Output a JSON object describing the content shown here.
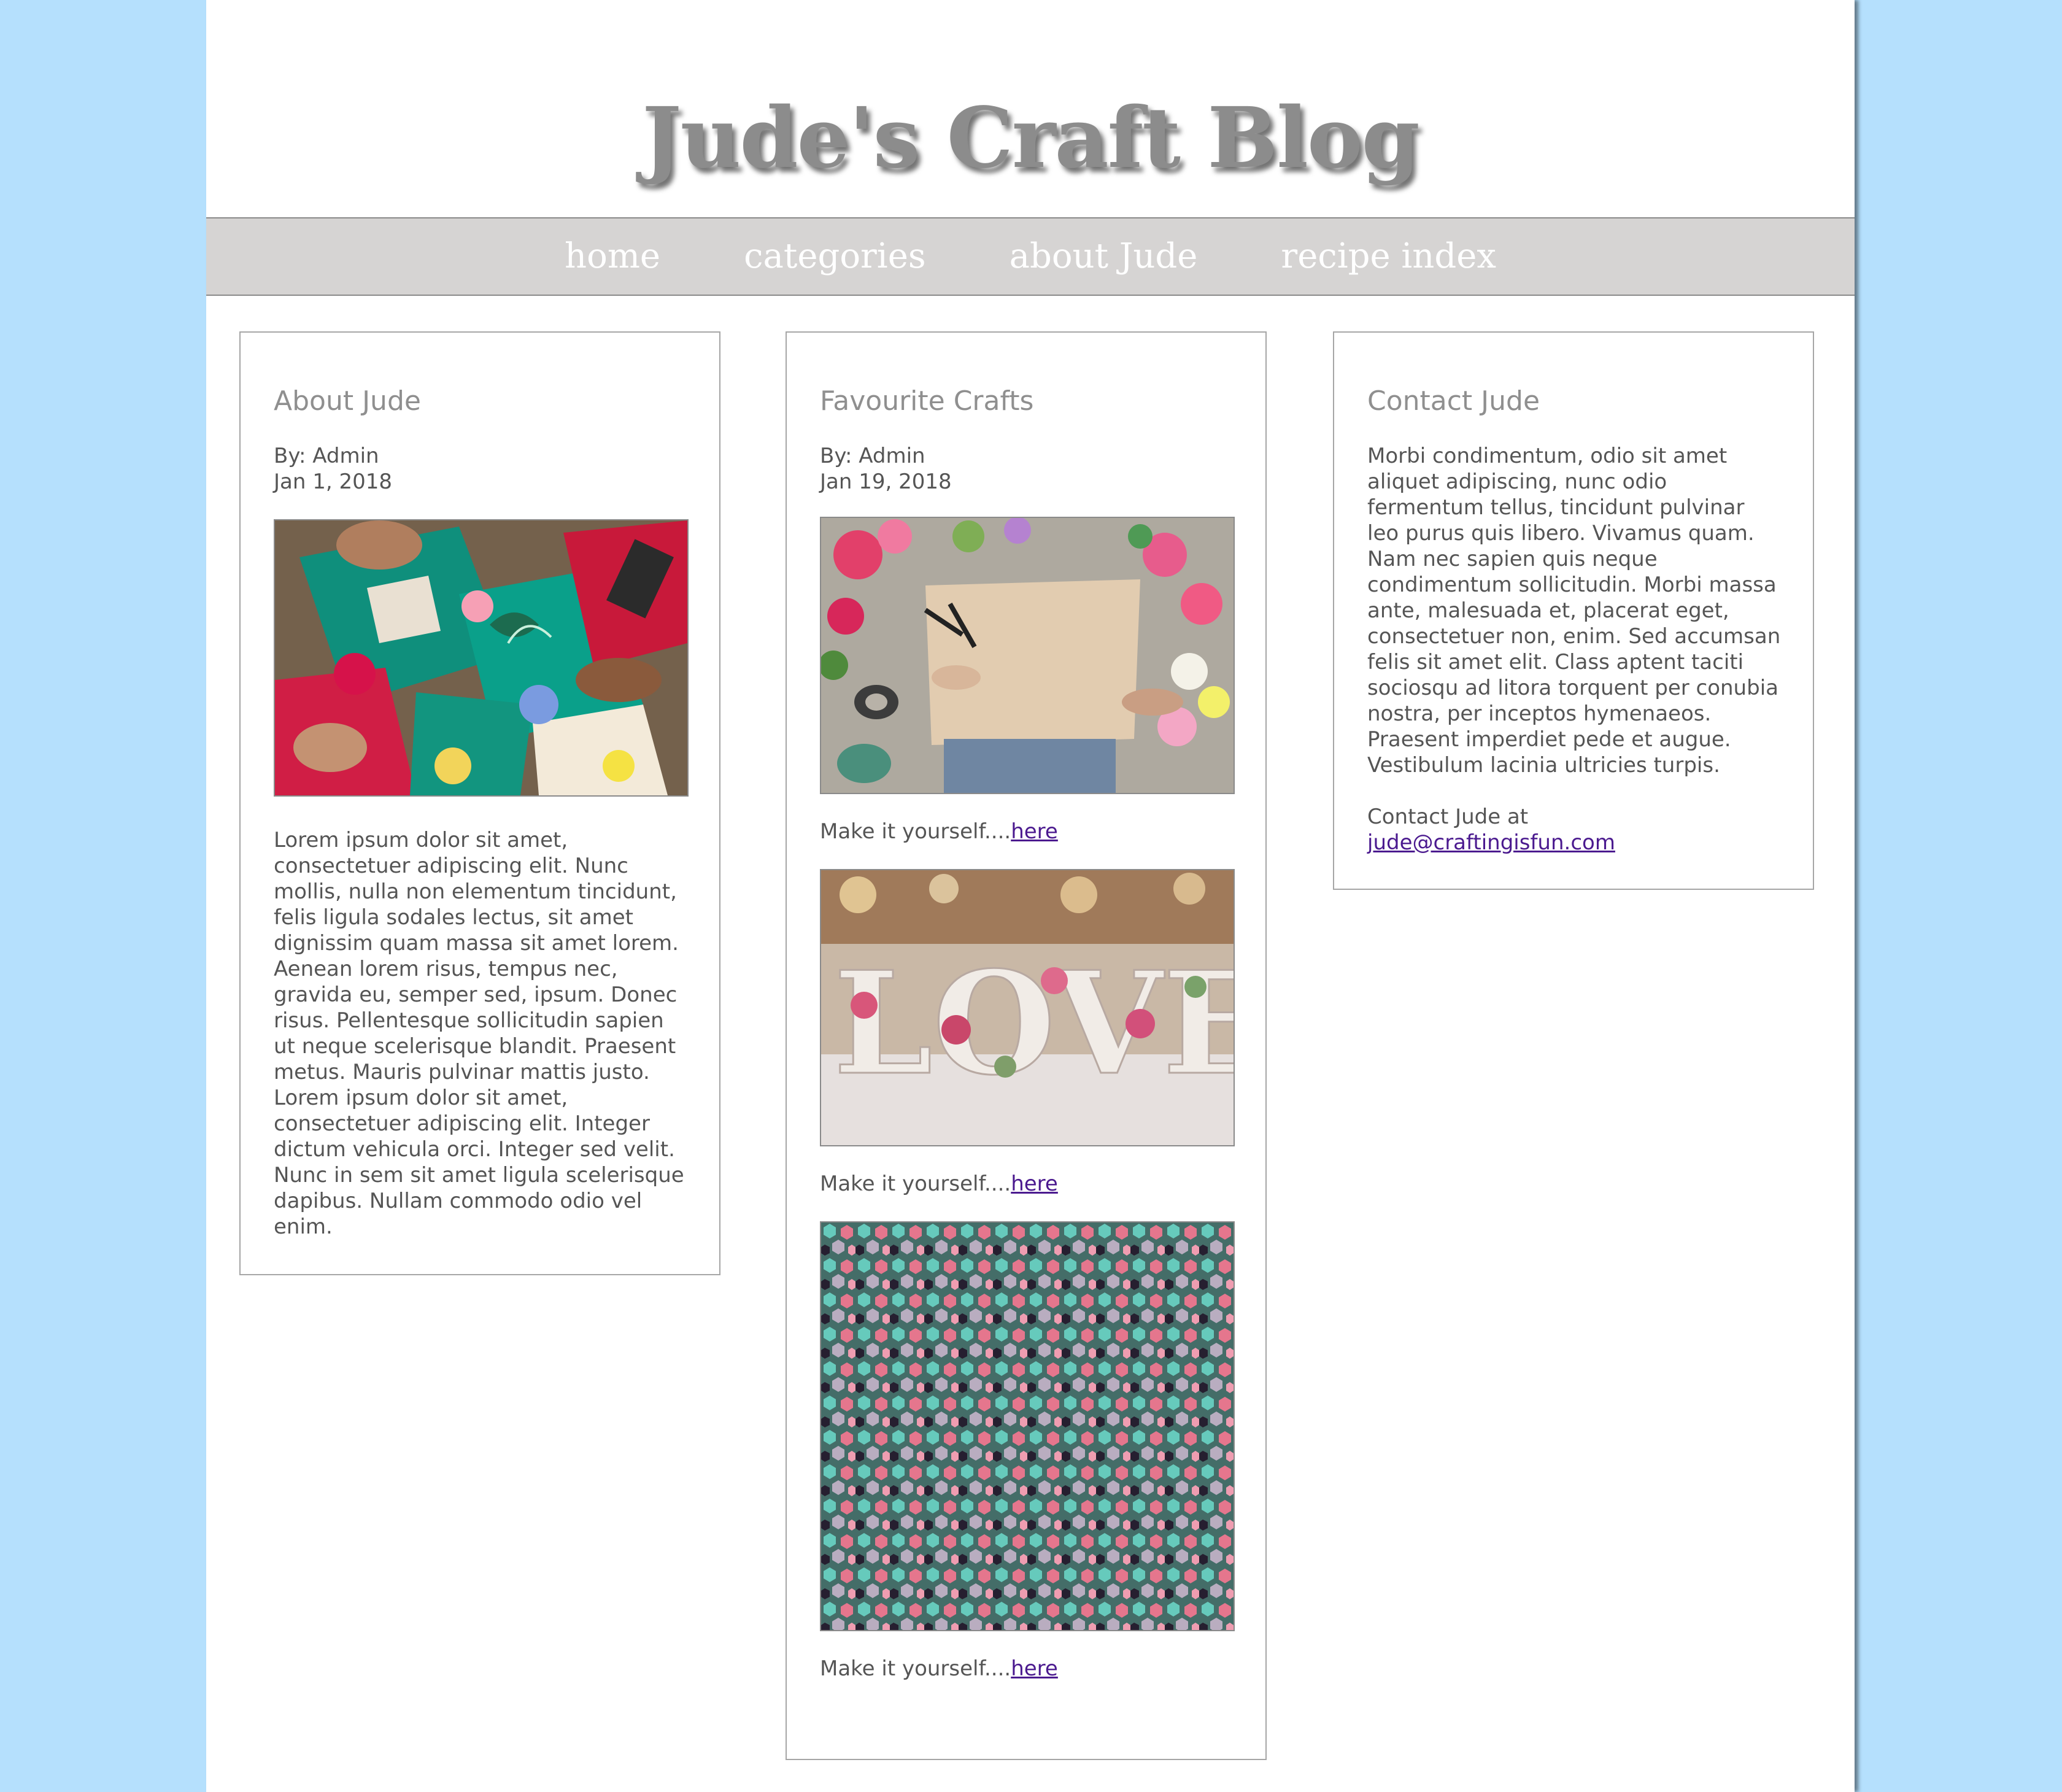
{
  "site": {
    "title": "Jude's Craft Blog"
  },
  "nav": {
    "items": [
      {
        "label": "home"
      },
      {
        "label": "categories"
      },
      {
        "label": "about Jude"
      },
      {
        "label": "recipe index"
      }
    ]
  },
  "about": {
    "heading": "About Jude",
    "author": "By: Admin",
    "date": "Jan 1, 2018",
    "image": "paper-crafts-photo",
    "body": "Lorem ipsum dolor sit amet, consectetuer adipiscing elit. Nunc mollis, nulla non elementum tincidunt, felis ligula sodales lectus, sit amet dignissim quam massa sit amet lorem. Aenean lorem risus, tempus nec, gravida eu, semper sed, ipsum. Donec risus. Pellentesque sollicitudin sapien ut neque scelerisque blandit. Praesent metus. Mauris pulvinar mattis justo. Lorem ipsum dolor sit amet, consectetuer adipiscing elit. Integer dictum vehicula orci. Integer sed velit. Nunc in sem sit amet ligula scelerisque dapibus. Nullam commodo odio vel enim."
  },
  "favourites": {
    "heading": "Favourite Crafts",
    "author": "By: Admin",
    "date": "Jan 19, 2018",
    "items": [
      {
        "image": "flowers-and-paper-photo",
        "caption": "Make it yourself....",
        "link": "here"
      },
      {
        "image": "love-letters-photo",
        "caption": "Make it yourself....",
        "link": "here"
      },
      {
        "image": "glitter-sequins-photo",
        "caption": "Make it yourself....",
        "link": "here"
      }
    ]
  },
  "contact": {
    "heading": "Contact Jude",
    "body": "Morbi condimentum, odio sit amet aliquet adipiscing, nunc odio fermentum tellus, tincidunt pulvinar leo purus quis libero. Vivamus quam. Nam nec sapien quis neque condimentum sollicitudin. Morbi massa ante, malesuada et, placerat eget, consectetuer non, enim. Sed accumsan felis sit amet elit. Class aptent taciti sociosqu ad litora torquent per conubia nostra, per inceptos hymenaeos. Praesent imperdiet pede et augue. Vestibulum lacinia ultricies turpis.",
    "contact_prefix": "Contact Jude at",
    "email": "jude@craftingisfun.com"
  },
  "colors": {
    "background": "#b5e0fd",
    "nav_bar": "#d6d4d3",
    "title": "#8c8c8c",
    "link": "#4b1a8f"
  }
}
